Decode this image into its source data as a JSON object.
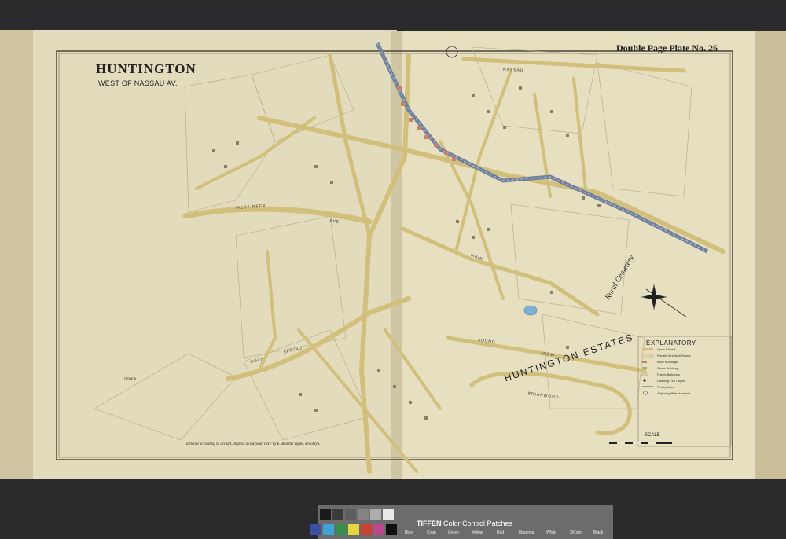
{
  "map": {
    "title": "HUNTINGTON",
    "subtitle": "WEST OF NASSAU AV.",
    "plate_label": "Double Page Plate No. 26",
    "estates_label": "HUNTINGTON ESTATES",
    "cemetery_label": "Rural Cemetery",
    "explanatory_title": "EXPLANATORY",
    "scale_label": "SCALE",
    "index_label": "INDEX",
    "credit": "Entered according to act of Congress in the year 1917 by E. Belcher Hyde, Brooklyn.",
    "streets": [
      "WEST NECK",
      "AVE",
      "COLD",
      "SPRING",
      "SOUND",
      "VIEW",
      "BRIARWOOD",
      "NASSAU",
      "MAIN"
    ],
    "explanatory_items": [
      "Open Streets",
      "Private Streets & Roads",
      "Brick Buildings",
      "Stone Buildings",
      "Frame Buildings",
      "Dwelling Fire Depth",
      "Trolley Lines",
      "Adjoining Plate Number"
    ]
  },
  "colorbar": {
    "brand": "TIFFEN",
    "title": "Color Control Patches",
    "patch_names": [
      "Blue",
      "Cyan",
      "Green",
      "Yellow",
      "Red",
      "Magenta",
      "White",
      "3/Color",
      "Black"
    ],
    "colors": [
      "#3a4fa0",
      "#3fa3d8",
      "#3a8f4a",
      "#e8d640",
      "#c8402f",
      "#b84a8c",
      "#f2f2f2",
      "#5a4a45",
      "#111111"
    ]
  },
  "colors": {
    "paper": "#ece6ca",
    "paper_edge": "#d8cfa8",
    "road": "#d9c98a",
    "railroad": "#7c8aa3",
    "lot_line": "#b8a98a",
    "building_red": "#c9826c",
    "pond": "#7fb0d8"
  }
}
